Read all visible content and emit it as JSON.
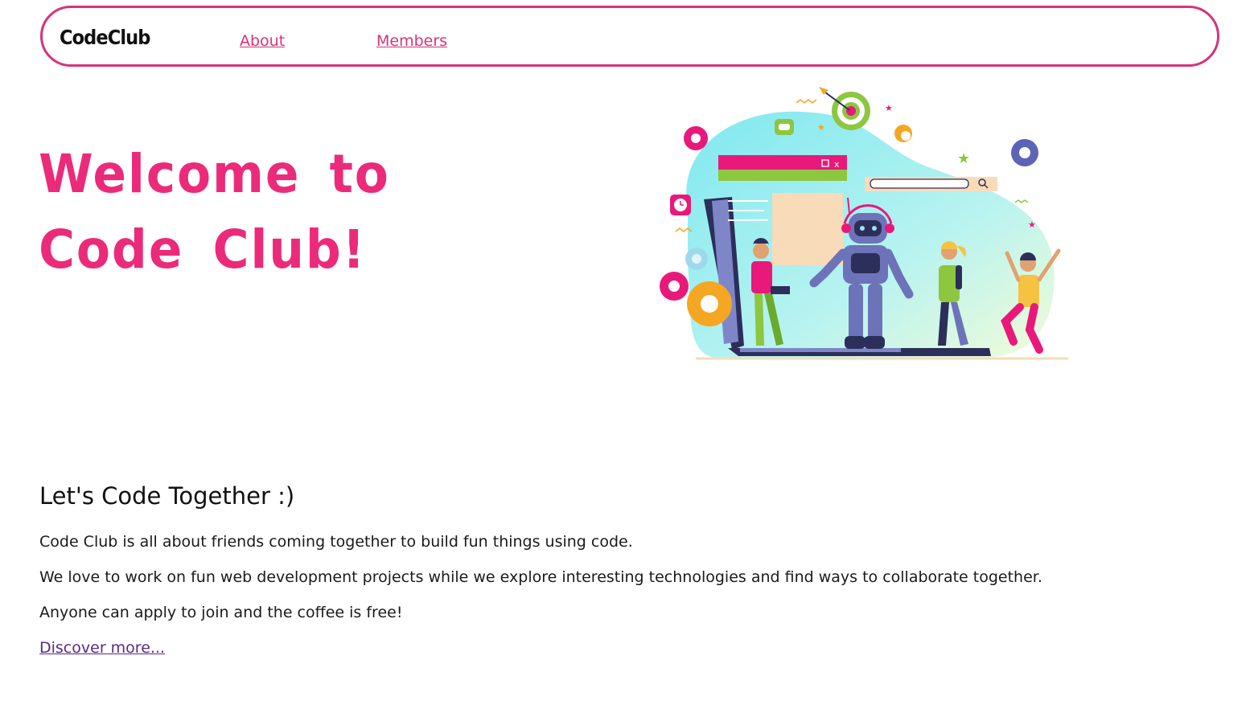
{
  "nav": {
    "brand": "CodeClub",
    "links": [
      "About",
      "Members"
    ]
  },
  "hero": {
    "title_line1": "Welcome to",
    "title_line2": "Code Club!",
    "illustration": {
      "window_controls": "□ x",
      "icons": [
        "target-icon",
        "gear-icon",
        "search-icon",
        "clock-icon",
        "gamepad-icon",
        "star-icon"
      ]
    }
  },
  "about": {
    "heading": "Let's Code Together :)",
    "paragraphs": [
      "Code Club is all about friends coming together to build fun things using code.",
      "We love to work on fun web development projects while we explore interesting technologies and find ways to collaborate together.",
      "Anyone can apply to join and the coffee is free!"
    ],
    "link": "Discover more..."
  },
  "colors": {
    "accent": "#ec2a7a",
    "nav_border": "#d6337a",
    "link_visited": "#5b2a86"
  }
}
